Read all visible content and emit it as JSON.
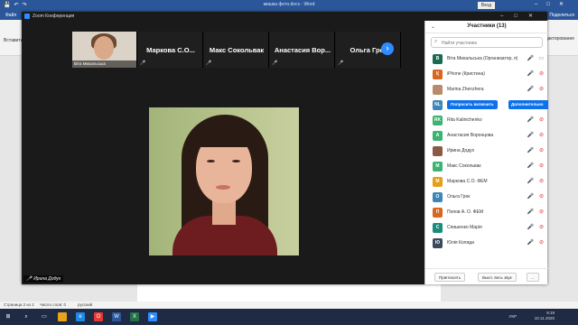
{
  "word": {
    "title": "мишка фото.docx  -  Word",
    "file_menu": "Файл",
    "share": "Поделиться",
    "signin": "Вход",
    "paste": "Вставить",
    "right_tools": "Редактирование",
    "status_page": "Страница 2 из 2",
    "status_words": "Число слов: 0",
    "status_lang": "русский"
  },
  "zoom": {
    "window_title": "Zoom Конференция",
    "speaker_name": "Ирина Додух",
    "thumb_name": "Віта Михальська",
    "strip_names": [
      "Маркова С.О...",
      "Макс Сокольвак",
      "Анастасия Вор...",
      "Ольга Грек"
    ],
    "colors": {
      "accent": "#2d8cff",
      "muted": "#e02828"
    }
  },
  "participants": {
    "title": "Участники (13)",
    "search_placeholder": "Найти участника",
    "ask_unmute": "Попросить включить",
    "more": "Дополнительно",
    "invite": "Пригласить",
    "mute_all": "Выкл. весь звук",
    "ellipsis": "...",
    "items": [
      {
        "initials": "В",
        "color": "#1a6b4f",
        "name": "Віта Михальська (Организатор, я)",
        "mic": "on"
      },
      {
        "initials": "I(",
        "color": "#d9651f",
        "name": "iPhone (Кристина)",
        "mic": "off"
      },
      {
        "initials": "",
        "color": "#b98b6c",
        "name": "Marina Zhenzhera",
        "mic": "off",
        "photo": true
      },
      {
        "initials": "NL",
        "color": "#3c86b8",
        "name": "",
        "mic": "off",
        "action": true
      },
      {
        "initials": "RK",
        "color": "#3cb371",
        "name": "Rita Kalinichenko",
        "mic": "off"
      },
      {
        "initials": "А",
        "color": "#3cb371",
        "name": "Анастасия Воронцова",
        "mic": "off"
      },
      {
        "initials": "",
        "color": "#8a5a44",
        "name": "Ирина Додух",
        "mic": "off",
        "photo": true
      },
      {
        "initials": "М",
        "color": "#3cb371",
        "name": "Макс Сокольвак",
        "mic": "off"
      },
      {
        "initials": "М",
        "color": "#e5a017",
        "name": "Маркова С.О. ФЕМ",
        "mic": "off"
      },
      {
        "initials": "О",
        "color": "#3c86b8",
        "name": "Ольга Грек",
        "mic": "off"
      },
      {
        "initials": "П",
        "color": "#d9651f",
        "name": "Попов А. О. ФЕМ",
        "mic": "off"
      },
      {
        "initials": "С",
        "color": "#1a8c7a",
        "name": "Спишенко Марія",
        "mic": "off"
      },
      {
        "initials": "Ю",
        "color": "#3a4a5c",
        "name": "Юлія Коляда",
        "mic": "off"
      }
    ]
  },
  "taskbar": {
    "lang": "УКР",
    "time": "9:19",
    "date": "10.11.2020"
  }
}
